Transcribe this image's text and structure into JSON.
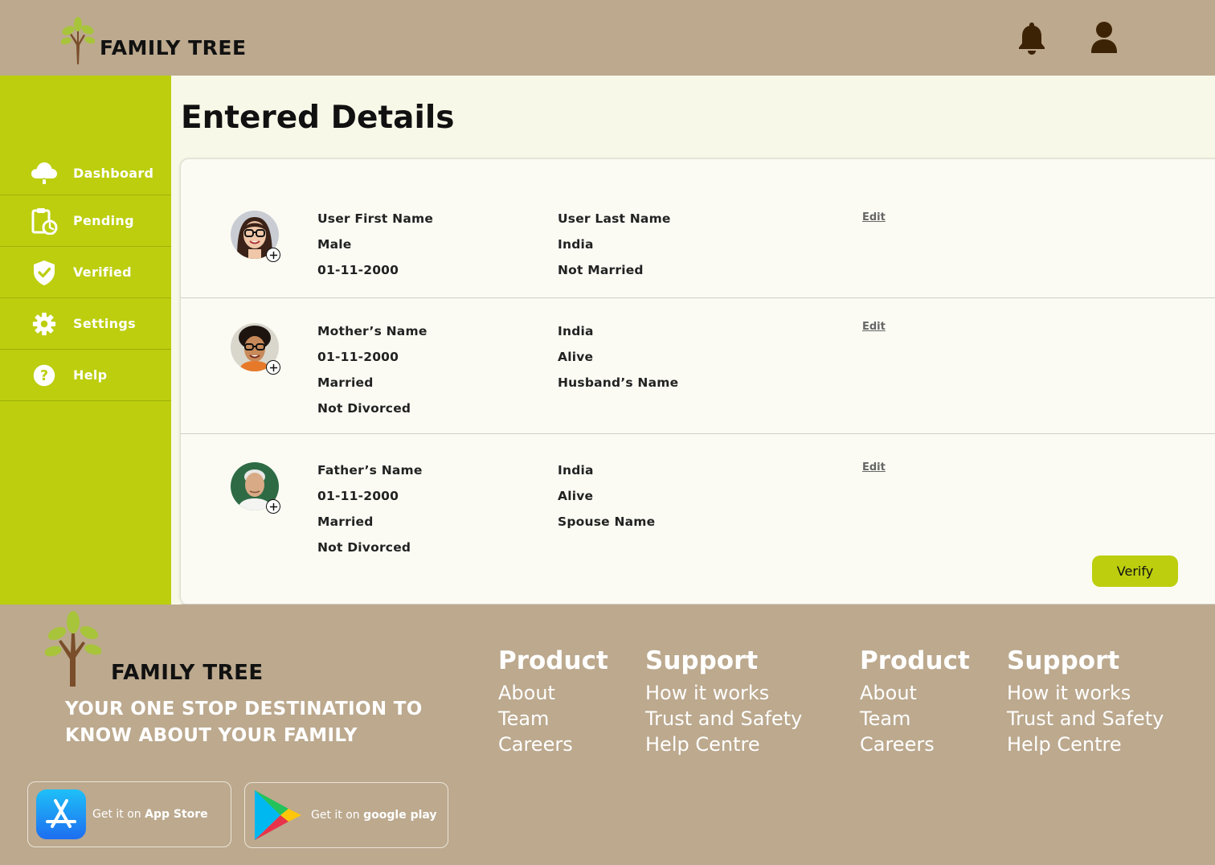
{
  "brand": {
    "name": "FAMILY TREE",
    "tagline": "YOUR ONE STOP DESTINATION TO KNOW ABOUT YOUR FAMILY"
  },
  "header": {
    "notification_icon": "bell-icon",
    "profile_icon": "user-icon"
  },
  "sidebar": {
    "items": [
      {
        "label": "Dashboard",
        "icon": "cloud-tree-icon"
      },
      {
        "label": "Pending",
        "icon": "clipboard-clock-icon"
      },
      {
        "label": "Verified",
        "icon": "shield-check-icon"
      },
      {
        "label": "Settings",
        "icon": "gear-icon"
      },
      {
        "label": "Help",
        "icon": "help-icon"
      }
    ]
  },
  "main": {
    "title": "Entered Details",
    "edit_label": "Edit",
    "verify_label": "Verify",
    "rows": [
      {
        "col1": [
          "User First Name",
          "Male",
          "01-11-2000"
        ],
        "col2": [
          "User Last Name",
          "India",
          "Not Married"
        ]
      },
      {
        "col1": [
          "Mother’s Name",
          "01-11-2000",
          "Married",
          "Not Divorced"
        ],
        "col2": [
          "India",
          "Alive",
          "Husband’s Name"
        ]
      },
      {
        "col1": [
          "Father’s Name",
          "01-11-2000",
          "Married",
          "Not Divorced"
        ],
        "col2": [
          "India",
          "Alive",
          "Spouse Name"
        ]
      }
    ]
  },
  "footer": {
    "columns": [
      {
        "heading": "Product",
        "links": [
          "About",
          "Team",
          "Careers"
        ]
      },
      {
        "heading": "Support",
        "links": [
          "How it works",
          "Trust and Safety",
          "Help Centre"
        ]
      },
      {
        "heading": "Product",
        "links": [
          "About",
          "Team",
          "Careers"
        ]
      },
      {
        "heading": "Support",
        "links": [
          "How it works",
          "Trust and Safety",
          "Help Centre"
        ]
      }
    ],
    "app_store": {
      "prefix": "Get it on",
      "name": "App Store"
    },
    "google_play": {
      "prefix": "Get it on",
      "name": "google play"
    }
  },
  "colors": {
    "header_bg": "#bca98e",
    "sidebar_bg": "#bcce0e",
    "main_bg": "#f8f8e8",
    "accent": "#bcce0e",
    "icon_dark": "#3d2306"
  }
}
